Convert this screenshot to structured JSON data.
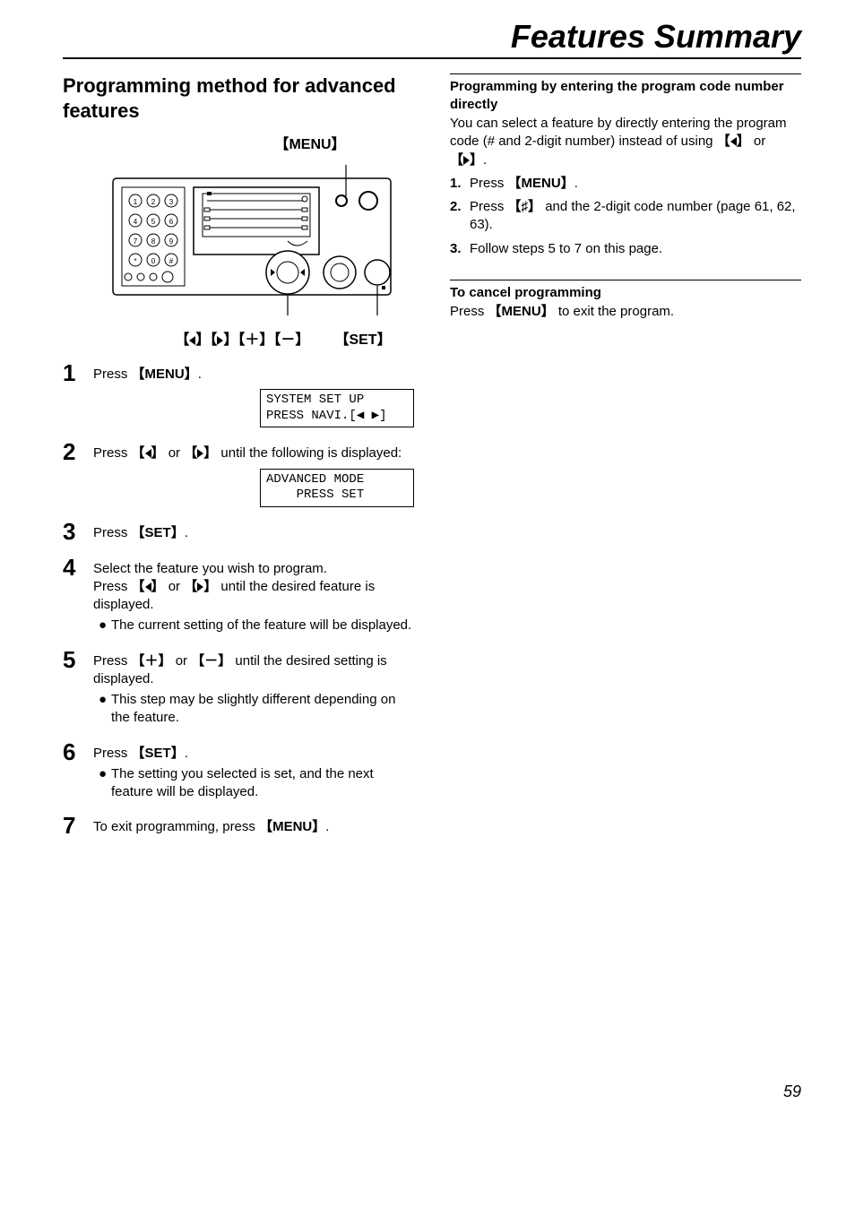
{
  "page_title": "Features Summary",
  "page_number": "59",
  "left": {
    "heading": "Programming method for advanced features",
    "labels": {
      "menu": "{MENU}",
      "navkeys": "{◀}{▶}{＋}{－}",
      "set": "{SET}"
    },
    "steps": [
      {
        "num": "1",
        "text_prefix": "Press ",
        "key": "{MENU}",
        "text_suffix": ".",
        "lcd": "SYSTEM SET UP\nPRESS NAVI.[◀ ▶]"
      },
      {
        "num": "2",
        "text_prefix": "Press ",
        "key1": "{◀}",
        "mid": " or ",
        "key2": "{▶}",
        "text_suffix": " until the following is displayed:",
        "lcd": "ADVANCED MODE\n    PRESS SET"
      },
      {
        "num": "3",
        "text_prefix": "Press ",
        "key": "{SET}",
        "text_suffix": "."
      },
      {
        "num": "4",
        "line1": "Select the feature you wish to program.",
        "line2_prefix": "Press ",
        "line2_key1": "{◀}",
        "line2_mid": " or ",
        "line2_key2": "{▶}",
        "line2_suffix": " until the desired feature is displayed.",
        "bullet": "The current setting of the feature will be displayed."
      },
      {
        "num": "5",
        "text_prefix": "Press ",
        "key1": "{＋}",
        "mid": " or ",
        "key2": "{－}",
        "text_suffix": " until the desired setting is displayed.",
        "bullet": "This step may be slightly different depending on the feature."
      },
      {
        "num": "6",
        "text_prefix": "Press ",
        "key": "{SET}",
        "text_suffix": ".",
        "bullet": "The setting you selected is set, and the next feature will be displayed."
      },
      {
        "num": "7",
        "text_prefix": "To exit programming, press ",
        "key": "{MENU}",
        "text_suffix": "."
      }
    ]
  },
  "right": {
    "sub1": {
      "heading": "Programming by entering the program code number directly",
      "para_prefix": "You can select a feature by directly entering the program code (# and 2-digit number) instead of using ",
      "key1": "{◀}",
      "mid": " or ",
      "key2": "{▶}",
      "suffix": ".",
      "items": [
        {
          "num": "1.",
          "prefix": "Press ",
          "key": "{MENU}",
          "suffix": "."
        },
        {
          "num": "2.",
          "prefix": "Press ",
          "key": "{♯}",
          "suffix": " and the 2-digit code number (page 61, 62, 63)."
        },
        {
          "num": "3.",
          "text": "Follow steps 5 to 7 on this page."
        }
      ]
    },
    "sub2": {
      "heading": "To cancel programming",
      "para_prefix": "Press ",
      "key": "{MENU}",
      "para_suffix": " to exit the program."
    }
  }
}
